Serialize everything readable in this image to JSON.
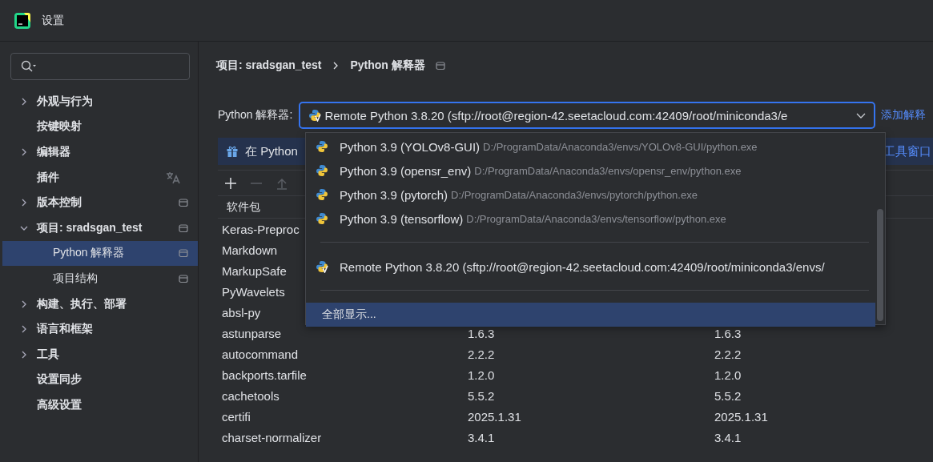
{
  "window": {
    "title": "设置"
  },
  "sidebar": {
    "items": [
      {
        "kind": "plain",
        "label": "外观与行为",
        "expanded": false,
        "selected": false
      },
      {
        "kind": "plain",
        "label": "按键映射",
        "selected": false
      },
      {
        "kind": "plain",
        "label": "编辑器",
        "expanded": false,
        "selected": false
      },
      {
        "kind": "translatable",
        "label": "插件",
        "selected": false
      },
      {
        "kind": "project",
        "label": "版本控制",
        "expanded": false,
        "selected": false
      },
      {
        "kind": "project",
        "label": "项目: sradsgan_test",
        "expanded": true,
        "selected": false,
        "children": [
          {
            "kind": "project",
            "label": "Python 解释器",
            "selected": true
          },
          {
            "kind": "project",
            "label": "项目结构",
            "selected": false
          }
        ]
      },
      {
        "kind": "plain",
        "label": "构建、执行、部署",
        "expanded": false,
        "selected": false
      },
      {
        "kind": "plain",
        "label": "语言和框架",
        "expanded": false,
        "selected": false
      },
      {
        "kind": "plain",
        "label": "工具",
        "expanded": false,
        "selected": false
      },
      {
        "kind": "plain",
        "label": "设置同步",
        "selected": false
      },
      {
        "kind": "plain",
        "label": "高级设置",
        "selected": false
      }
    ]
  },
  "breadcrumb": [
    "项目: sradsgan_test",
    "Python 解释器"
  ],
  "interpreter": {
    "label": "Python 解释器:",
    "value": "Remote Python 3.8.20 (sftp://root@region-42.seetacloud.com:42409/root/miniconda3/e",
    "add_link": "添加解释"
  },
  "banner": {
    "text": "在 Python",
    "link": "工具窗口"
  },
  "dropdown": {
    "items": [
      {
        "kind": "local",
        "name": "Python 3.9 (YOLOv8-GUI)",
        "path": "D:/ProgramData/Anaconda3/envs/YOLOv8-GUI/python.exe",
        "selected": false
      },
      {
        "kind": "local",
        "name": "Python 3.9 (opensr_env)",
        "path": "D:/ProgramData/Anaconda3/envs/opensr_env/python.exe",
        "selected": false
      },
      {
        "kind": "local",
        "name": "Python 3.9 (pytorch)",
        "path": "D:/ProgramData/Anaconda3/envs/pytorch/python.exe",
        "selected": false
      },
      {
        "kind": "local",
        "name": "Python 3.9 (tensorflow)",
        "path": "D:/ProgramData/Anaconda3/envs/tensorflow/python.exe",
        "selected": false
      },
      {
        "kind": "separator"
      },
      {
        "kind": "remote",
        "name": "Remote Python 3.8.20 (sftp://root@region-42.seetacloud.com:42409/root/miniconda3/envs/",
        "selected": false
      },
      {
        "kind": "separator"
      },
      {
        "kind": "action",
        "name": "全部显示...",
        "selected": true
      }
    ]
  },
  "table": {
    "columns": [
      "软件包"
    ],
    "rows": [
      [
        "Keras-Preproc"
      ],
      [
        "Markdown"
      ],
      [
        "MarkupSafe"
      ],
      [
        "PyWavelets"
      ],
      [
        "absl-py"
      ],
      [
        "astunparse",
        "1.6.3",
        "1.6.3"
      ],
      [
        "autocommand",
        "2.2.2",
        "2.2.2"
      ],
      [
        "backports.tarfile",
        "1.2.0",
        "1.2.0"
      ],
      [
        "cachetools",
        "5.5.2",
        "5.5.2"
      ],
      [
        "certifi",
        "2025.1.31",
        "2025.1.31"
      ],
      [
        "charset-normalizer",
        "3.4.1",
        "3.4.1"
      ]
    ]
  }
}
